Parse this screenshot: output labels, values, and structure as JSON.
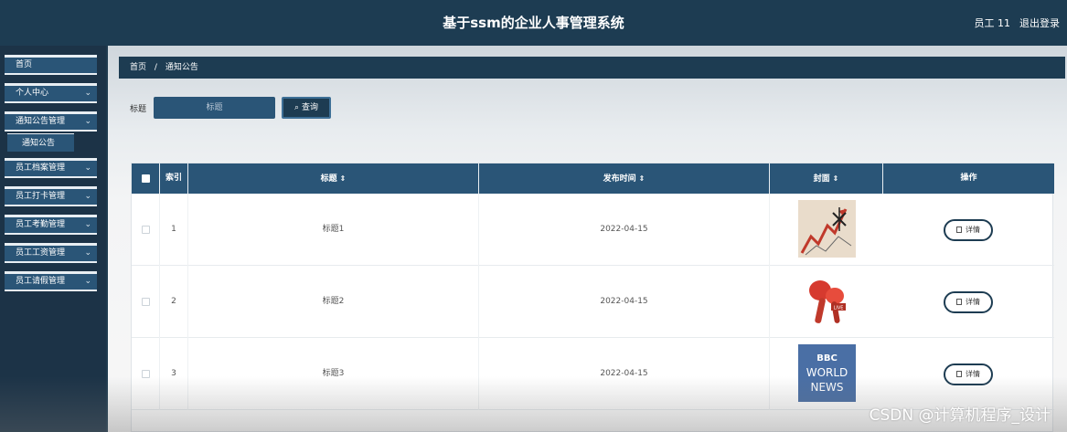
{
  "header": {
    "title": "基于ssm的企业人事管理系统",
    "user": "员工 11",
    "logout": "退出登录"
  },
  "sidebar": {
    "items": [
      {
        "label": "首页",
        "chevron": false
      },
      {
        "label": "个人中心",
        "chevron": true
      },
      {
        "label": "通知公告管理",
        "chevron": true
      },
      {
        "label": "员工档案管理",
        "chevron": true
      },
      {
        "label": "员工打卡管理",
        "chevron": true
      },
      {
        "label": "员工考勤管理",
        "chevron": true
      },
      {
        "label": "员工工资管理",
        "chevron": true
      },
      {
        "label": "员工请假管理",
        "chevron": true
      }
    ],
    "submenu": {
      "label": "通知公告"
    }
  },
  "breadcrumb": {
    "home": "首页",
    "separator": "/",
    "current": "通知公告"
  },
  "search": {
    "label": "标题",
    "placeholder": "标题",
    "button": "查询"
  },
  "table": {
    "columns": {
      "index": "索引",
      "title": "标题",
      "time": "发布时间",
      "cover": "封面",
      "action": "操作"
    },
    "sort_glyph": "⇕",
    "rows": [
      {
        "index": "1",
        "title": "标题1",
        "time": "2022-04-15",
        "cover": "chart-arrow-cover",
        "action": "详情"
      },
      {
        "index": "2",
        "title": "标题2",
        "time": "2022-04-15",
        "cover": "microphone-live-cover",
        "action": "详情"
      },
      {
        "index": "3",
        "title": "标题3",
        "time": "2022-04-15",
        "cover": "bbc-world-news-cover",
        "action": "详情"
      }
    ]
  },
  "cover_text": {
    "bbc": "BBC",
    "world": "WORLD",
    "news": "NEWS",
    "live": "LIVE"
  },
  "watermark": "CSDN @计算机程序_设计",
  "colors": {
    "header": "#1d3c52",
    "accent": "#2a5577"
  }
}
